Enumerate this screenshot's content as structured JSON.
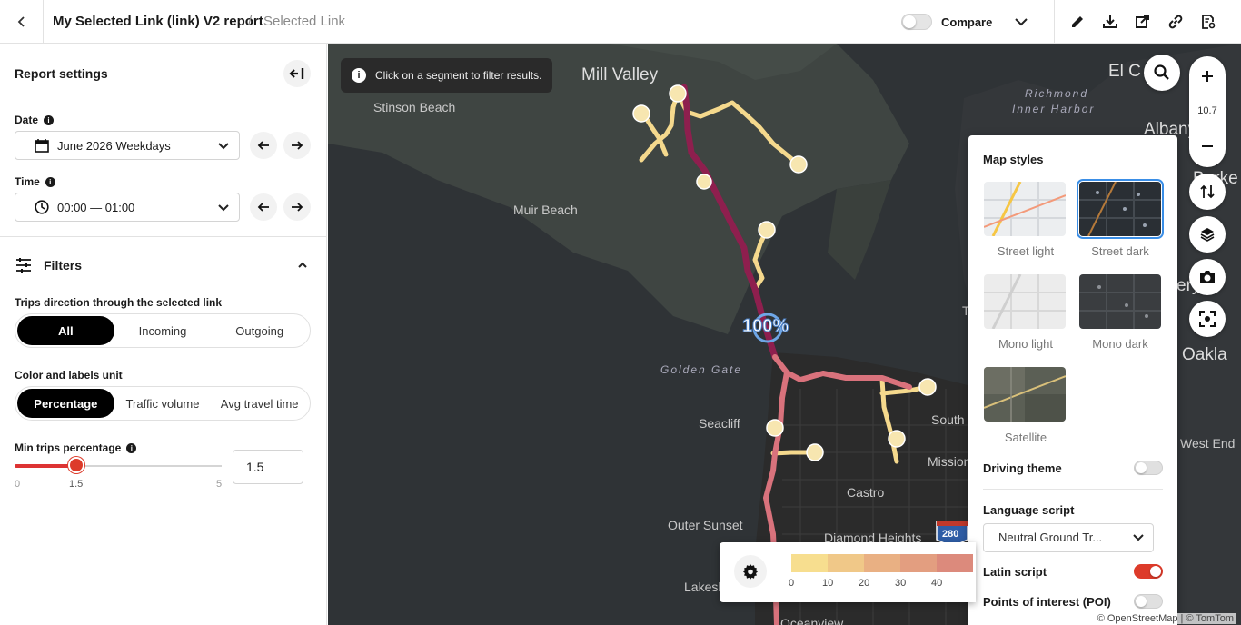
{
  "header": {
    "title": "My Selected Link (link) V2 report",
    "separator": "/",
    "subtitle": "Selected Link",
    "compare_label": "Compare"
  },
  "sidebar": {
    "title": "Report settings",
    "date": {
      "label": "Date",
      "value": "June 2026 Weekdays"
    },
    "time": {
      "label": "Time",
      "value": "00:00 — 01:00"
    },
    "filters": {
      "label": "Filters",
      "direction": {
        "label": "Trips direction through the selected link",
        "options": [
          "All",
          "Incoming",
          "Outgoing"
        ],
        "selected": "All"
      },
      "unit": {
        "label": "Color and labels unit",
        "options": [
          "Percentage",
          "Traffic volume",
          "Avg travel time"
        ],
        "selected": "Percentage"
      },
      "min_trips": {
        "label": "Min trips percentage",
        "min": "0",
        "max": "5",
        "value": 1.5,
        "value_text": "1.5",
        "input_value": "1.5"
      }
    }
  },
  "map": {
    "hint": "Click on a segment to filter results.",
    "zoom_level": "10.7",
    "selected_link_label": "100%",
    "place_labels": [
      "Mill Valley",
      "Stinson Beach",
      "Muir Beach",
      "Golden Gate",
      "Seacliff",
      "South Be",
      "Mission",
      "Castro",
      "Outer Sunset",
      "Diamond Heights",
      "Lakesh",
      "Oceanview",
      "Richmond",
      "Inner Harbor",
      "El C",
      "Albany",
      "Berke",
      "Oakla",
      "ery",
      "West End",
      "T",
      "280"
    ],
    "attribution": "© OpenStreetMap | © TomTom"
  },
  "map_styles": {
    "title": "Map styles",
    "styles": [
      {
        "label": "Street light",
        "selected": false
      },
      {
        "label": "Street dark",
        "selected": true
      },
      {
        "label": "Mono light",
        "selected": false
      },
      {
        "label": "Mono dark",
        "selected": false
      },
      {
        "label": "Satellite",
        "selected": false
      }
    ],
    "driving_theme": {
      "label": "Driving theme",
      "on": false
    },
    "language_script": {
      "label": "Language script",
      "value": "Neutral Ground Tr..."
    },
    "latin_script": {
      "label": "Latin script",
      "on": true
    },
    "poi": {
      "label": "Points of interest (POI)",
      "on": false
    }
  },
  "legend": {
    "ticks": [
      "0",
      "10",
      "20",
      "30",
      "40"
    ],
    "colors": [
      "#f7de8f",
      "#f0c888",
      "#e9b083",
      "#e39e80",
      "#dc8a7c"
    ]
  },
  "colors": {
    "accent": "#dd3b2a",
    "route_strong": "#8e1f4e",
    "route_weak": "#f5d98d",
    "selected_outline": "#3a8ee6"
  }
}
